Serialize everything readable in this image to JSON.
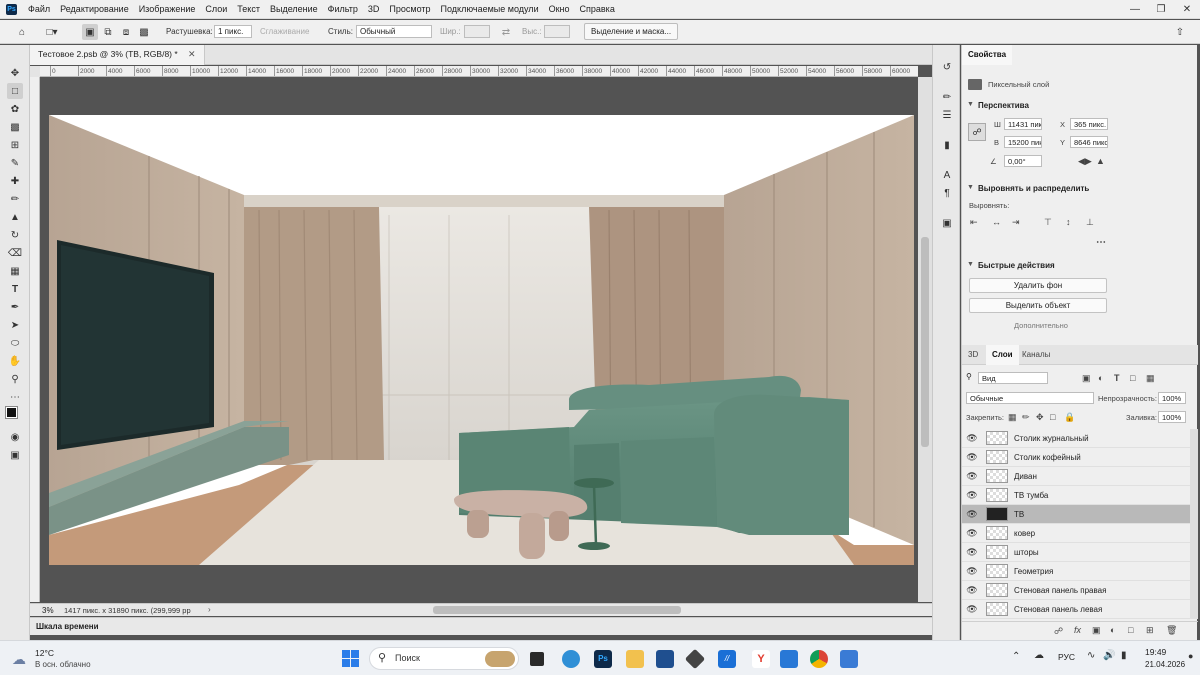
{
  "menubar": {
    "logo": "Ps",
    "items": [
      "Файл",
      "Редактирование",
      "Изображение",
      "Слои",
      "Текст",
      "Выделение",
      "Фильтр",
      "3D",
      "Просмотр",
      "Подключаемые модули",
      "Окно",
      "Справка"
    ]
  },
  "options": {
    "feather_label": "Растушевка:",
    "feather_value": "1 пикс.",
    "antialias_label": "Сглаживание",
    "style_label": "Стиль:",
    "style_value": "Обычный",
    "width_label": "Шир.:",
    "height_label": "Выс.:",
    "select_mask_button": "Выделение и маска..."
  },
  "document": {
    "tab_title": "Тестовое 2.psb @ 3% (ТВ, RGB/8) *",
    "zoom": "3%",
    "doc_info": "1417 пикс. x 31890 пикс. (299,999 pp"
  },
  "ruler_ticks": [
    "0",
    "2000",
    "4000",
    "6000",
    "8000",
    "10000",
    "12000",
    "14000",
    "16000",
    "18000",
    "20000",
    "22000",
    "24000",
    "26000",
    "28000",
    "30000",
    "32000",
    "34000",
    "36000",
    "38000",
    "40000",
    "42000",
    "44000",
    "46000",
    "48000",
    "50000",
    "52000",
    "54000",
    "56000",
    "58000",
    "60000"
  ],
  "timeline_label": "Шкала времени",
  "properties": {
    "tab": "Свойства",
    "layer_type": "Пиксельный слой",
    "perspective_title": "Перспектива",
    "w_label": "Ш",
    "w_value": "11431 пик",
    "x_label": "X",
    "x_value": "365 пикс.",
    "h_label": "В",
    "h_value": "15200 пик",
    "y_label": "Y",
    "y_value": "8646 пикс.",
    "angle_value": "0,00°",
    "align_title": "Выровнять и распределить",
    "align_label": "Выровнять:",
    "quick_title": "Быстрые действия",
    "remove_bg_button": "Удалить фон",
    "select_subject_button": "Выделить объект",
    "more_label": "Дополнительно"
  },
  "layers_panel": {
    "tabs": [
      "3D",
      "Слои",
      "Каналы"
    ],
    "active_tab": "Слои",
    "filter_kind": "Вид",
    "blend_mode": "Обычные",
    "opacity_label": "Непрозрачность:",
    "opacity_value": "100%",
    "lock_label": "Закрепить:",
    "fill_label": "Заливка:",
    "fill_value": "100%",
    "layers": [
      {
        "name": "Столик журнальный",
        "selected": false
      },
      {
        "name": "Столик кофейный",
        "selected": false
      },
      {
        "name": "Диван",
        "selected": false
      },
      {
        "name": "ТВ тумба",
        "selected": false
      },
      {
        "name": "ТВ",
        "selected": true
      },
      {
        "name": "ковер",
        "selected": false
      },
      {
        "name": "шторы",
        "selected": false
      },
      {
        "name": "Геометрия",
        "selected": false
      },
      {
        "name": "Стеновая панель правая",
        "selected": false
      },
      {
        "name": "Стеновая панель левая",
        "selected": false
      }
    ]
  },
  "taskbar": {
    "weather_temp": "12°C",
    "weather_desc": "В осн. облачно",
    "search_placeholder": "Поиск",
    "lang": "РУС",
    "time": "19:49",
    "date": "21.04.2026"
  },
  "colors": {
    "accent": "#31a8ff",
    "sofa": "#5f8b7a",
    "wall": "#b9a796",
    "curtain": "#b29b86",
    "floor": "#c49a7a"
  }
}
